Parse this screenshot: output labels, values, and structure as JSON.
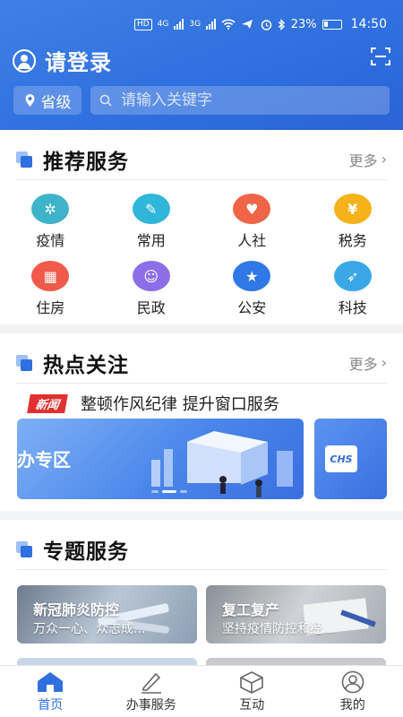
{
  "status_bar": {
    "signal_4g": "4G",
    "signal_3g": "3G",
    "battery": "23%",
    "time": "14:50",
    "hd_label": "HD"
  },
  "header": {
    "login_text": "请登录",
    "location_label": "省级",
    "search_placeholder": "请输入关键字"
  },
  "recommended": {
    "title": "推荐服务",
    "more_label": "更多",
    "items": [
      {
        "label": "疫情",
        "icon": "epidemic-icon",
        "color": "#3fb3c9"
      },
      {
        "label": "常用",
        "icon": "clipboard-icon",
        "color": "#2fb6d9"
      },
      {
        "label": "人社",
        "icon": "heart-hands-icon",
        "color": "#f06447"
      },
      {
        "label": "税务",
        "icon": "yuan-coin-icon",
        "color": "#f5b21a"
      },
      {
        "label": "住房",
        "icon": "building-icon",
        "color": "#f05a4a"
      },
      {
        "label": "民政",
        "icon": "family-icon",
        "color": "#8e6ee8"
      },
      {
        "label": "公安",
        "icon": "police-badge-icon",
        "color": "#2f78e6"
      },
      {
        "label": "科技",
        "icon": "rocket-icon",
        "color": "#3aa8e8"
      }
    ]
  },
  "hot": {
    "title": "热点关注",
    "more_label": "更多",
    "news_tag": "新闻",
    "news_text": "整顿作风纪律 提升窗口服务",
    "banner_text": "办专区",
    "banner2_logo": "CHS"
  },
  "topics": {
    "title": "专题服务",
    "items": [
      {
        "title": "新冠肺炎防控",
        "subtitle": "万众一心、众志成..."
      },
      {
        "title": "复工复产",
        "subtitle": "坚持疫情防控和经..."
      }
    ]
  },
  "tabbar": {
    "items": [
      {
        "label": "首页",
        "icon": "home-icon"
      },
      {
        "label": "办事服务",
        "icon": "pen-icon"
      },
      {
        "label": "互动",
        "icon": "cube-icon"
      },
      {
        "label": "我的",
        "icon": "user-icon"
      }
    ]
  }
}
